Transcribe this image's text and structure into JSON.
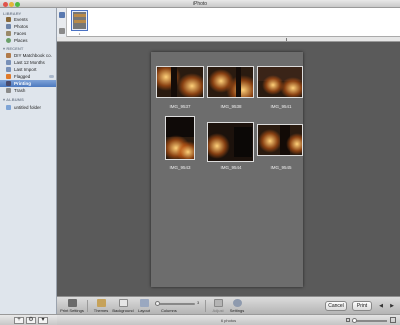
{
  "window": {
    "title": "iPhoto"
  },
  "sidebar": {
    "sections": [
      {
        "header": "LIBRARY",
        "items": [
          {
            "label": "Events",
            "icon": "events-icon",
            "color": "#8a6a3a"
          },
          {
            "label": "Photos",
            "icon": "photos-icon",
            "color": "#6d84a8"
          },
          {
            "label": "Faces",
            "icon": "faces-icon",
            "color": "#9a8a6a"
          },
          {
            "label": "Places",
            "icon": "places-icon",
            "color": "#6aa06a"
          }
        ]
      },
      {
        "header": "RECENT",
        "items": [
          {
            "label": "DIY Matchbook co...",
            "icon": "event-icon",
            "color": "#b07a4a"
          },
          {
            "label": "Last 12 Months",
            "icon": "calendar-icon",
            "color": "#7890b8"
          },
          {
            "label": "Last Import",
            "icon": "import-icon",
            "color": "#7890b8"
          },
          {
            "label": "Flagged",
            "icon": "flag-icon",
            "color": "#e07a2a"
          },
          {
            "label": "Printing",
            "icon": "printer-icon",
            "color": "#4a4a6a",
            "selected": true
          },
          {
            "label": "Trash",
            "icon": "trash-icon",
            "color": "#8a8a8a"
          }
        ]
      },
      {
        "header": "ALBUMS",
        "items": [
          {
            "label": "untitled folder",
            "icon": "folder-icon",
            "color": "#7ea4d6"
          }
        ]
      }
    ],
    "bottom_buttons": [
      "+",
      "⚙",
      "▾"
    ]
  },
  "strip": {
    "count_label": "1"
  },
  "page": {
    "photos": [
      {
        "caption": "IMG_9537"
      },
      {
        "caption": "IMG_9538"
      },
      {
        "caption": "IMG_9541"
      },
      {
        "caption": "IMG_9543"
      },
      {
        "caption": "IMG_9544"
      },
      {
        "caption": "IMG_9545"
      }
    ]
  },
  "toolbar": {
    "print_settings": "Print Settings",
    "themes": "Themes",
    "background": "Background",
    "layout": "Layout",
    "columns": "Columns",
    "columns_value": "3",
    "adjust": "Adjust",
    "settings": "Settings",
    "cancel": "Cancel",
    "print": "Print"
  },
  "status": {
    "text": "6 photos"
  },
  "colors": {
    "selection": "#4c79bf",
    "sidebar_bg": "#dfe5ec",
    "canvas_bg": "#5a5a5a",
    "page_bg": "#6d6d6d"
  }
}
